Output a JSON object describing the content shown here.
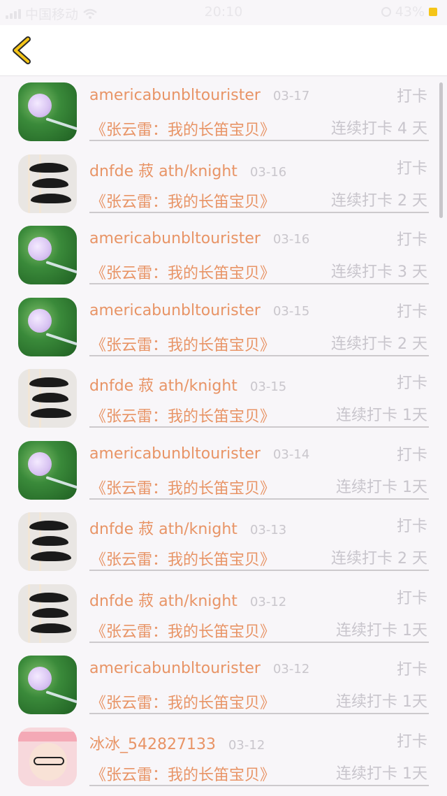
{
  "status_bar": {
    "carrier": "中国移动",
    "time": "20:10",
    "battery": "43%"
  },
  "nav": {
    "back_icon": "chevron-left-icon"
  },
  "entries": [
    {
      "name": "americabunbltourister",
      "date": "03-17",
      "action": "打卡",
      "book": "《张云雷：我的长笛宝贝》",
      "streak": "连续打卡 4 天",
      "avatar": "bell"
    },
    {
      "name": "dnfde 菽 ath/knight",
      "date": "03-16",
      "action": "打卡",
      "book": "《张云雷：我的长笛宝贝》",
      "streak": "连续打卡 2 天",
      "avatar": "mustache"
    },
    {
      "name": "americabunbltourister",
      "date": "03-16",
      "action": "打卡",
      "book": "《张云雷：我的长笛宝贝》",
      "streak": "连续打卡 3 天",
      "avatar": "bell"
    },
    {
      "name": "americabunbltourister",
      "date": "03-15",
      "action": "打卡",
      "book": "《张云雷：我的长笛宝贝》",
      "streak": "连续打卡 2 天",
      "avatar": "bell"
    },
    {
      "name": "dnfde 菽 ath/knight",
      "date": "03-15",
      "action": "打卡",
      "book": "《张云雷：我的长笛宝贝》",
      "streak": "连续打卡 1天",
      "avatar": "mustache"
    },
    {
      "name": "americabunbltourister",
      "date": "03-14",
      "action": "打卡",
      "book": "《张云雷：我的长笛宝贝》",
      "streak": "连续打卡 1天",
      "avatar": "bell"
    },
    {
      "name": "dnfde 菽 ath/knight",
      "date": "03-13",
      "action": "打卡",
      "book": "《张云雷：我的长笛宝贝》",
      "streak": "连续打卡 2 天",
      "avatar": "mustache"
    },
    {
      "name": "dnfde 菽 ath/knight",
      "date": "03-12",
      "action": "打卡",
      "book": "《张云雷：我的长笛宝贝》",
      "streak": "连续打卡 1天",
      "avatar": "mustache"
    },
    {
      "name": "americabunbltourister",
      "date": "03-12",
      "action": "打卡",
      "book": "《张云雷：我的长笛宝贝》",
      "streak": "连续打卡 1天",
      "avatar": "bell"
    },
    {
      "name": "冰冰_542827133",
      "date": "03-12",
      "action": "打卡",
      "book": "《张云雷：我的长笛宝贝》",
      "streak": "连续打卡 1天",
      "avatar": "baby"
    }
  ],
  "colors": {
    "accent": "#e89466",
    "muted": "#c8c5cc",
    "back_icon": "#f5c518"
  }
}
